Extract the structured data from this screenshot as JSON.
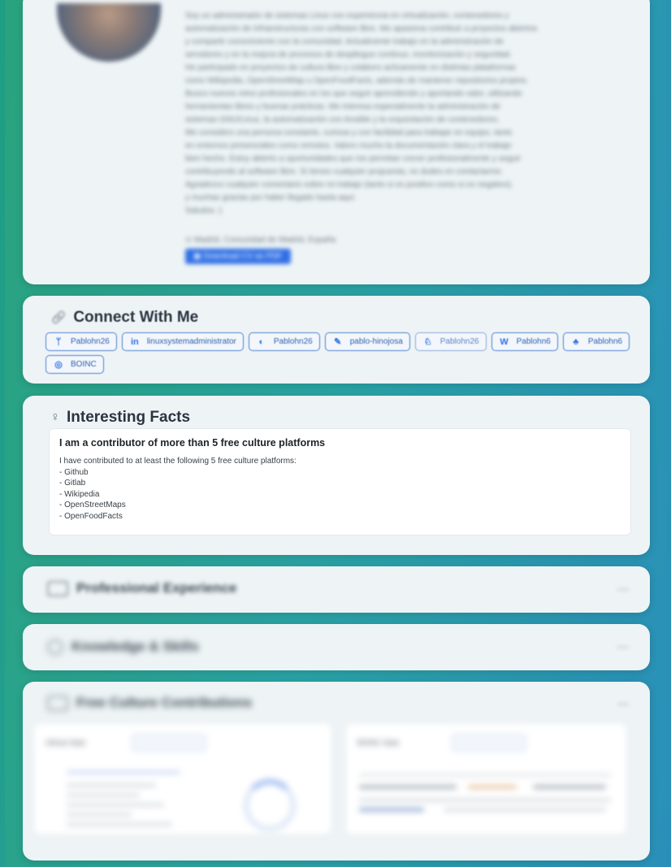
{
  "profile": {
    "bio_lines": [
      "Soy un administrador de sistemas Linux con experiencia en virtualización, contenedores y",
      "automatización de infraestructuras con software libre. Me apasiona contribuir a proyectos abiertos",
      "y compartir conocimiento con la comunidad. Actualmente trabajo en la administración de",
      "servidores y en la mejora de procesos de despliegue continuo, monitorización y seguridad.",
      "He participado en proyectos de cultura libre y colaboro activamente en distintas plataformas",
      "como Wikipedia, OpenStreetMap u OpenFoodFacts, además de mantener repositorios propios.",
      "Busco nuevos retos profesionales en los que seguir aprendiendo y aportando valor, utilizando",
      "herramientas libres y buenas prácticas. Me interesa especialmente la administración de",
      "sistemas GNU/Linux, la automatización con Ansible y la orquestación de contenedores.",
      "Me considero una persona constante, curiosa y con facilidad para trabajar en equipo, tanto",
      "en entornos presenciales como remotos. Valoro mucho la documentación clara y el trabajo",
      "bien hecho. Estoy abierto a oportunidades que me permitan crecer profesionalmente y seguir",
      "contribuyendo al software libre. Si tienes cualquier propuesta, no dudes en contactarme.",
      "Agradezco cualquier comentario sobre mi trabajo (tanto si es positivo como si es negativo),",
      "y muchas gracias por haber llegado hasta aquí.",
      "Saludos :)"
    ],
    "location": "Madrid, Comunidad de Madrid, España",
    "download_label": "Download CV as PDF"
  },
  "connect": {
    "title": "Connect With Me",
    "icon": "link-icon",
    "chips": [
      {
        "icon": "git-icon",
        "glyph": "ᛘ",
        "label": "Pablohn26"
      },
      {
        "icon": "linkedin-icon",
        "glyph": "in",
        "label": "linuxsystemadministrator"
      },
      {
        "icon": "github-icon",
        "glyph": "◐",
        "label": "Pablohn26"
      },
      {
        "icon": "blog-icon",
        "glyph": "✎",
        "label": "pablo-hinojosa"
      },
      {
        "icon": "gitlab-icon",
        "glyph": "♘",
        "label": "Pablohn26"
      },
      {
        "icon": "wikipedia-icon",
        "glyph": "W",
        "label": "Pablohn6"
      },
      {
        "icon": "community-icon",
        "glyph": "♣",
        "label": "Pablohn6"
      },
      {
        "icon": "chip-icon",
        "glyph": "◎",
        "label": "BOINC"
      }
    ]
  },
  "facts": {
    "title": "Interesting Facts",
    "icon": "lightbulb-icon",
    "item_title": "I am a contributor of more than 5 free culture platforms",
    "item_lines": [
      "I have contributed to at least the following 5 free culture platforms:",
      "- Github",
      "- Gitlab",
      "- Wikipedia",
      "- OpenStreetMaps",
      "- OpenFoodFacts"
    ]
  },
  "sections": {
    "experience": "Professional Experience",
    "knowledge": "Knowledge & Skills",
    "free_culture": "Free Culture Contributions",
    "collapse_glyph": "—"
  },
  "free_culture": {
    "panel1_title": "Github Stats",
    "panel2_title": "BOINC Stats"
  },
  "colors": {
    "accent": "#2f6fe4",
    "card_bg": "#eef4f6",
    "bg_green": "#29a37d",
    "bg_blue": "#2a90b9"
  }
}
